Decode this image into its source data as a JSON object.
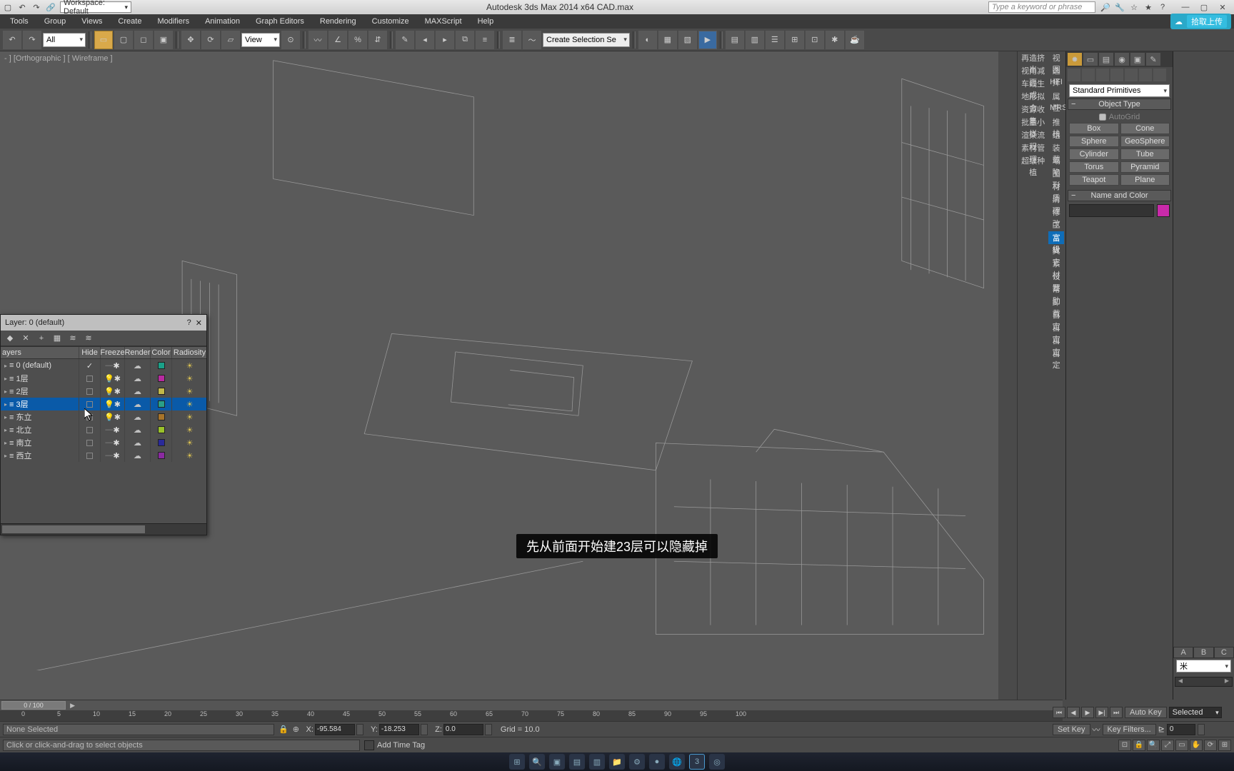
{
  "title_bar": {
    "workspace_label": "Workspace: Default",
    "app_title": "Autodesk 3ds Max  2014 x64     CAD.max",
    "search_placeholder": "Type a keyword or phrase"
  },
  "menu": {
    "items": [
      "Tools",
      "Group",
      "Views",
      "Create",
      "Modifiers",
      "Animation",
      "Graph Editors",
      "Rendering",
      "Customize",
      "MAXScript",
      "Help"
    ],
    "share_label": "拾取上传"
  },
  "toolbar": {
    "sel_all": "All",
    "ref_mode": "View",
    "create_set": "Create Selection Se"
  },
  "viewport": {
    "label": "- ] [Orthographic ] [ Wireframe ]"
  },
  "side_labels": {
    "rows": [
      [
        "再造挤出",
        "视图"
      ],
      [
        "视角减面",
        "选择"
      ],
      [
        "车线生成",
        "HFI"
      ],
      [
        "地形拟合",
        "属性"
      ],
      [
        "资源收集",
        "MRS"
      ],
      [
        "批量小样",
        "推栈"
      ],
      [
        "渲染流程",
        "组"
      ],
      [
        "素材管理",
        "装载"
      ],
      [
        "超级种植",
        "塌陷"
      ],
      [
        "",
        "图形"
      ],
      [
        "",
        "材质"
      ],
      [
        "",
        "清理"
      ],
      [
        "",
        "修改"
      ],
      [
        "",
        "工具"
      ],
      [
        "",
        "富级"
      ],
      [
        "",
        "其它"
      ],
      [
        "",
        "素材"
      ],
      [
        "",
        "设置"
      ],
      [
        "",
        "帮助"
      ],
      [
        "",
        "卸载"
      ],
      [
        "",
        "自定"
      ],
      [
        "",
        "自定"
      ],
      [
        "",
        "自定"
      ],
      [
        "",
        "自定"
      ]
    ],
    "active_index": 14
  },
  "command_panel": {
    "category": "Standard Primitives",
    "rollout_type": "Object Type",
    "autogrid": "AutoGrid",
    "primitives": [
      [
        "Box",
        "Cone"
      ],
      [
        "Sphere",
        "GeoSphere"
      ],
      [
        "Cylinder",
        "Tube"
      ],
      [
        "Torus",
        "Pyramid"
      ],
      [
        "Teapot",
        "Plane"
      ]
    ],
    "rollout_name": "Name and Color"
  },
  "right_strip": {
    "abc": [
      "A",
      "B",
      "C"
    ],
    "unit": "米"
  },
  "layer_dialog": {
    "title": "Layer: 0 (default)",
    "columns": [
      "ayers",
      "Hide",
      "Freeze",
      "Render",
      "Color",
      "Radiosity"
    ],
    "rows": [
      {
        "name": "0 (default)",
        "hide": "check",
        "freeze": "—",
        "color": "#1aa088",
        "sel": false
      },
      {
        "name": "1层",
        "hide": "box",
        "freeze": "bulb",
        "color": "#b82aa0",
        "sel": false
      },
      {
        "name": "2层",
        "hide": "box",
        "freeze": "bulb",
        "color": "#c2b84a",
        "sel": false
      },
      {
        "name": "3层",
        "hide": "box",
        "freeze": "bulb",
        "color": "#2aa088",
        "sel": true
      },
      {
        "name": "东立",
        "hide": "box",
        "freeze": "bulb",
        "color": "#a8742a",
        "sel": false
      },
      {
        "name": "北立",
        "hide": "box",
        "freeze": "—",
        "color": "#9ac22a",
        "sel": false
      },
      {
        "name": "南立",
        "hide": "box",
        "freeze": "—",
        "color": "#2a2a9a",
        "sel": false
      },
      {
        "name": "西立",
        "hide": "box",
        "freeze": "—",
        "color": "#8a2aa0",
        "sel": false
      }
    ]
  },
  "time": {
    "slider": "0 / 100",
    "ticks": [
      0,
      5,
      10,
      15,
      20,
      25,
      30,
      35,
      40,
      45,
      50,
      55,
      60,
      65,
      70,
      75,
      80,
      85,
      90,
      95,
      100
    ]
  },
  "status": {
    "selection": "None Selected",
    "x": "-95.584",
    "y": "-18.253",
    "z": "0.0",
    "grid": "Grid = 10.0",
    "add_tag": "Add Time Tag",
    "prompt": "Click or click-and-drag to select objects"
  },
  "key": {
    "auto": "Auto Key",
    "mode": "Selected",
    "set": "Set Key",
    "filters": "Key Filters...",
    "frame": "0"
  },
  "subtitle": "先从前面开始建23层可以隐藏掉",
  "taskbar": {
    "items": [
      "⊞",
      "🔍",
      "▣",
      "▤",
      "▥",
      "📁",
      "⚙",
      "●",
      "🌐",
      "3",
      "◎"
    ]
  }
}
